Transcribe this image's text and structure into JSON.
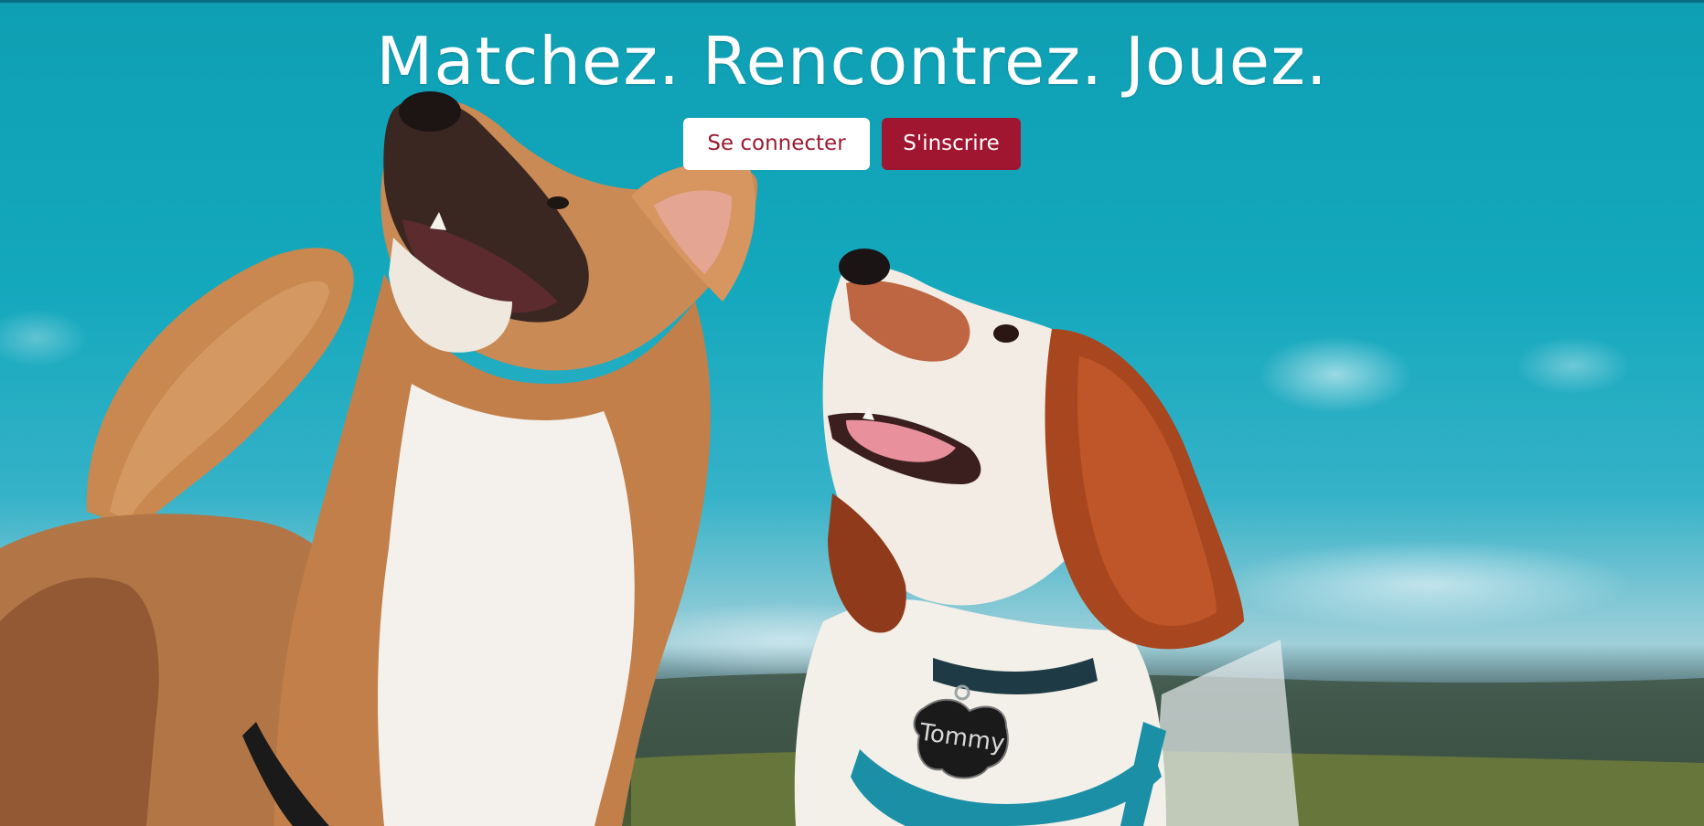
{
  "hero": {
    "headline": "Matchez. Rencontrez. Jouez.",
    "background_image": "two-dogs-looking-up-sky-photo",
    "dog_tag_text": "Tommy"
  },
  "actions": {
    "login_label": "Se connecter",
    "signup_label": "S'inscrire"
  },
  "colors": {
    "brand": "#a01530",
    "login_text": "#9b1b30",
    "sky": "#14a8bd"
  }
}
